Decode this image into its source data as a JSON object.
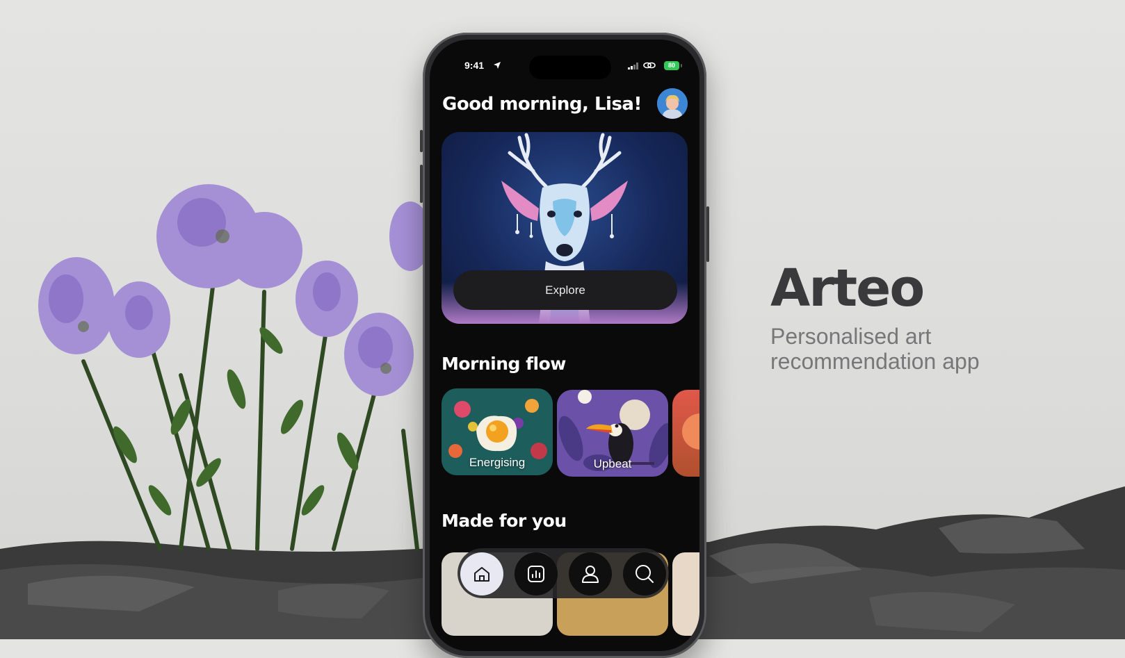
{
  "brand": {
    "title": "Arteo",
    "subtitle": "Personalised art recommendation app"
  },
  "status_bar": {
    "time": "9:41",
    "battery": "80"
  },
  "home": {
    "greeting": "Good morning, Lisa!",
    "hero": {
      "explore_label": "Explore"
    },
    "morning_flow": {
      "title": "Morning flow",
      "cards": [
        {
          "label": "Energising"
        },
        {
          "label": "Upbeat"
        }
      ]
    },
    "made_for_you": {
      "title": "Made for you"
    }
  },
  "tab_bar": {
    "items": [
      {
        "icon": "home-icon",
        "active": true
      },
      {
        "icon": "stats-icon",
        "active": false
      },
      {
        "icon": "profile-icon",
        "active": false
      },
      {
        "icon": "search-icon",
        "active": false
      }
    ]
  },
  "colors": {
    "screen_bg": "#0a0a0b",
    "battery": "#34c759",
    "brand_text": "#3a3a3c",
    "subtitle_text": "#77777a"
  }
}
